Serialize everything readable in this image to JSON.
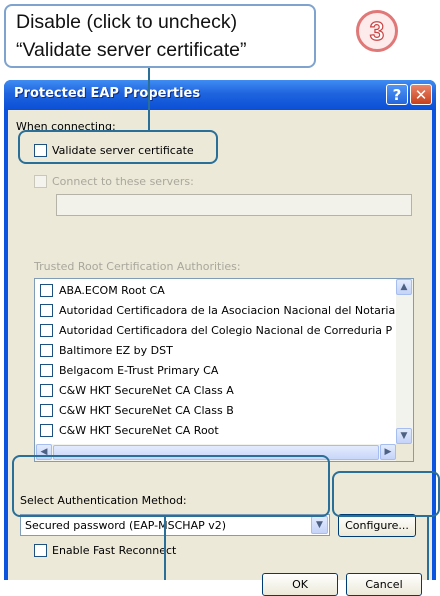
{
  "callout": {
    "line1": "Disable (click to uncheck)",
    "line2": "“Validate server certificate”"
  },
  "step_number": "3",
  "window": {
    "title": "Protected EAP Properties",
    "help_glyph": "?",
    "close_glyph": "✕"
  },
  "dialog": {
    "when_connecting_label": "When connecting:",
    "validate_cert_label": "Validate server certificate",
    "connect_servers_label": "Connect to these servers:",
    "connect_servers_value": "",
    "trusted_root_label": "Trusted Root Certification Authorities:",
    "trusted_roots": [
      "ABA.ECOM Root CA",
      "Autoridad Certificadora de la Asociacion Nacional del Notaria",
      "Autoridad Certificadora del Colegio Nacional de Correduria P",
      "Baltimore EZ by DST",
      "Belgacom E-Trust Primary CA",
      "C&W HKT SecureNet CA Class A",
      "C&W HKT SecureNet CA Class B",
      "C&W HKT SecureNet CA Root"
    ],
    "auth_method_label": "Select Authentication Method:",
    "auth_method_value": "Secured password (EAP-MSCHAP v2)",
    "configure_label": "Configure...",
    "fast_reconnect_label": "Enable Fast Reconnect",
    "ok_label": "OK",
    "cancel_label": "Cancel"
  },
  "icons": {
    "scroll_up": "▲",
    "scroll_down": "▼",
    "scroll_left": "◀",
    "scroll_right": "▶",
    "combo_arrow": "▼"
  },
  "colors": {
    "title_bar": "#0a54e0",
    "dialog_bg": "#ece9d8",
    "highlight": "#2a6f97",
    "step_badge": "#e07878"
  }
}
